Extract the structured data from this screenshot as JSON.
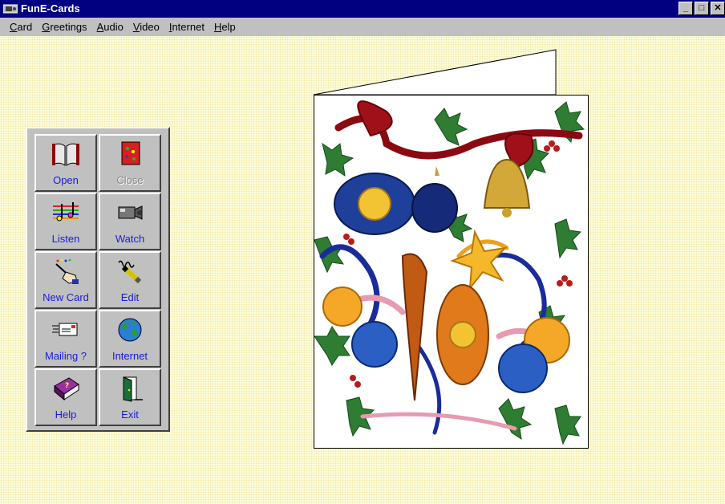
{
  "window": {
    "title": "FunE-Cards",
    "minimize": "_",
    "maximize": "□",
    "close": "✕"
  },
  "menu": {
    "items": [
      "Card",
      "Greetings",
      "Audio",
      "Video",
      "Internet",
      "Help"
    ],
    "underline": [
      "C",
      "G",
      "A",
      "V",
      "I",
      "H"
    ]
  },
  "toolbox": {
    "buttons": [
      {
        "id": "open",
        "label": "Open",
        "icon": "open-book-icon",
        "enabled": true
      },
      {
        "id": "close",
        "label": "Close",
        "icon": "card-close-icon",
        "enabled": false
      },
      {
        "id": "listen",
        "label": "Listen",
        "icon": "music-notes-icon",
        "enabled": true
      },
      {
        "id": "watch",
        "label": "Watch",
        "icon": "video-camera-icon",
        "enabled": true
      },
      {
        "id": "new-card",
        "label": "New Card",
        "icon": "magic-wand-hand-icon",
        "enabled": true
      },
      {
        "id": "edit",
        "label": "Edit",
        "icon": "pen-writing-icon",
        "enabled": true
      },
      {
        "id": "mailing",
        "label": "Mailing ?",
        "icon": "envelope-icon",
        "enabled": true
      },
      {
        "id": "internet",
        "label": "Internet",
        "icon": "globe-icon",
        "enabled": true
      },
      {
        "id": "help",
        "label": "Help",
        "icon": "help-book-icon",
        "enabled": true
      },
      {
        "id": "exit",
        "label": "Exit",
        "icon": "door-exit-icon",
        "enabled": true
      }
    ]
  },
  "card": {
    "image": "christmas-ornaments-holly-illustration"
  },
  "colors": {
    "titlebar": "#000080",
    "chrome": "#c0c0c0",
    "client_bg": "#fcfcd8",
    "label_blue": "#1a1ae0"
  }
}
